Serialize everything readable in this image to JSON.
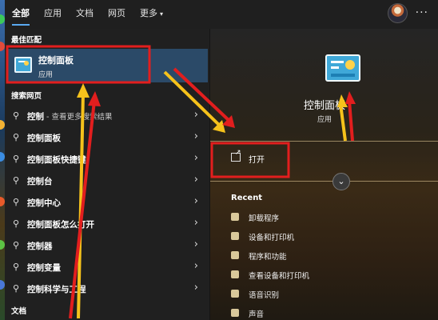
{
  "tabs": [
    {
      "label": "全部",
      "active": true
    },
    {
      "label": "应用",
      "active": false
    },
    {
      "label": "文档",
      "active": false
    },
    {
      "label": "网页",
      "active": false
    },
    {
      "label": "更多",
      "active": false
    }
  ],
  "tabs_more_caret": "▾",
  "header_more": "···",
  "left": {
    "best_match_title": "最佳匹配",
    "best_match": {
      "name": "控制面板",
      "type": "应用",
      "icon": "control-panel-icon"
    },
    "web_title": "搜索网页",
    "web_results": [
      {
        "main": "控制",
        "sub": " - 查看更多搜索结果"
      },
      {
        "main": "控制面板",
        "sub": ""
      },
      {
        "main": "控制面板快捷键",
        "sub": ""
      },
      {
        "main": "控制台",
        "sub": ""
      },
      {
        "main": "控制中心",
        "sub": ""
      },
      {
        "main": "控制面板怎么打开",
        "sub": ""
      },
      {
        "main": "控制器",
        "sub": ""
      },
      {
        "main": "控制变量",
        "sub": ""
      },
      {
        "main": "控制科学与工程",
        "sub": ""
      }
    ],
    "docs_title": "文档"
  },
  "right": {
    "title": "控制面板",
    "subtitle": "应用",
    "open_label": "打开",
    "recent_title": "Recent",
    "recent_items": [
      "卸载程序",
      "设备和打印机",
      "程序和功能",
      "查看设备和打印机",
      "语音识别",
      "声音"
    ]
  },
  "colors": {
    "accent": "#5aa9f0",
    "selection": "#2b4a68",
    "annotation_red": "#e21e1e",
    "annotation_yellow": "#f6c21b"
  }
}
